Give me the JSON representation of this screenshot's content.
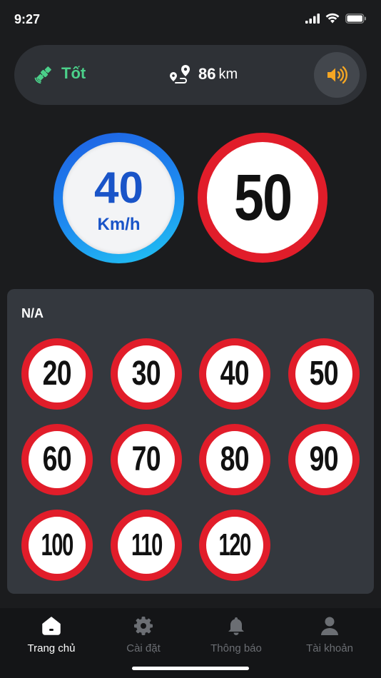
{
  "status": {
    "time": "9:27"
  },
  "info": {
    "gps_status": "Tốt",
    "distance_value": "86",
    "distance_unit": "km"
  },
  "current_speed": {
    "value": "40",
    "unit": "Km/h"
  },
  "speed_limit": {
    "value": "50"
  },
  "panel": {
    "label": "N/A",
    "signs": [
      "20",
      "30",
      "40",
      "50",
      "60",
      "70",
      "80",
      "90",
      "100",
      "110",
      "120"
    ]
  },
  "tabs": [
    {
      "label": "Trang chủ",
      "icon": "home-icon",
      "active": true
    },
    {
      "label": "Cài đặt",
      "icon": "gear-icon",
      "active": false
    },
    {
      "label": "Thông báo",
      "icon": "bell-icon",
      "active": false
    },
    {
      "label": "Tài khoản",
      "icon": "user-icon",
      "active": false
    }
  ],
  "colors": {
    "gps_good": "#4bd08a",
    "limit_ring": "#e11d2a",
    "current_speed_blue": "#1954c8",
    "sound_icon": "#f5a623"
  }
}
